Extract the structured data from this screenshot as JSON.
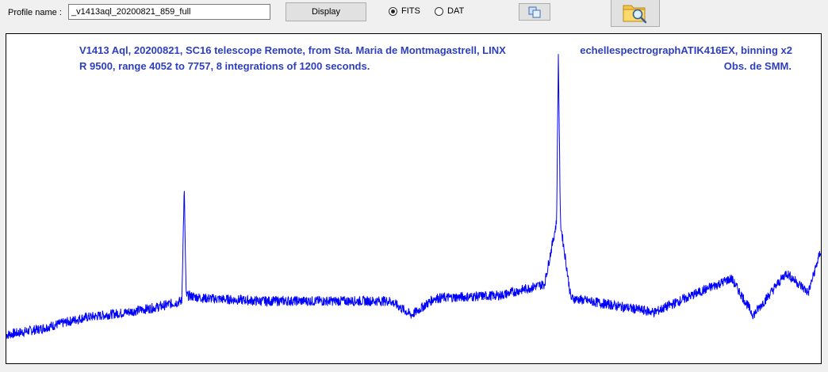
{
  "toolbar": {
    "profile_label": "Profile name :",
    "profile_value": "_v1413aql_20200821_859_full",
    "display_label": "Display",
    "format_options": [
      {
        "label": "FITS",
        "selected": true
      },
      {
        "label": "DAT",
        "selected": false
      }
    ],
    "copy_icon": "copy-icon",
    "open_icon": "folder-search-icon"
  },
  "plot": {
    "line_color": "#0000ff",
    "caption_color": "#2d3fbf",
    "caption_line1_left": "V1413 Aql,  20200821, SC16 telescope Remote, from Sta. Maria de Montmagastrell, LINX",
    "caption_line1_right": "echellespectrographATIK416EX, binning x2",
    "caption_line2_left": "R 9500,  range  4052 to 7757,  8 integrations of 1200 seconds.",
    "caption_line2_right": "Obs. de SMM."
  },
  "chart_data": {
    "type": "line",
    "xlim": [
      4052,
      7757
    ],
    "series": [
      {
        "x": [
          4052,
          4200,
          4400,
          4600,
          4750,
          4850,
          4861,
          4870,
          4950,
          5200,
          5500,
          5800,
          5895,
          6000,
          6300,
          6500,
          6555,
          6563,
          6572,
          6620,
          6700,
          6850,
          7000,
          7200,
          7350,
          7450,
          7600,
          7700,
          7757
        ],
        "y": [
          0.0,
          0.02,
          0.06,
          0.08,
          0.1,
          0.12,
          0.52,
          0.14,
          0.13,
          0.12,
          0.12,
          0.12,
          0.07,
          0.13,
          0.14,
          0.18,
          0.4,
          1.0,
          0.4,
          0.13,
          0.12,
          0.1,
          0.08,
          0.15,
          0.2,
          0.07,
          0.22,
          0.15,
          0.3
        ]
      }
    ]
  }
}
